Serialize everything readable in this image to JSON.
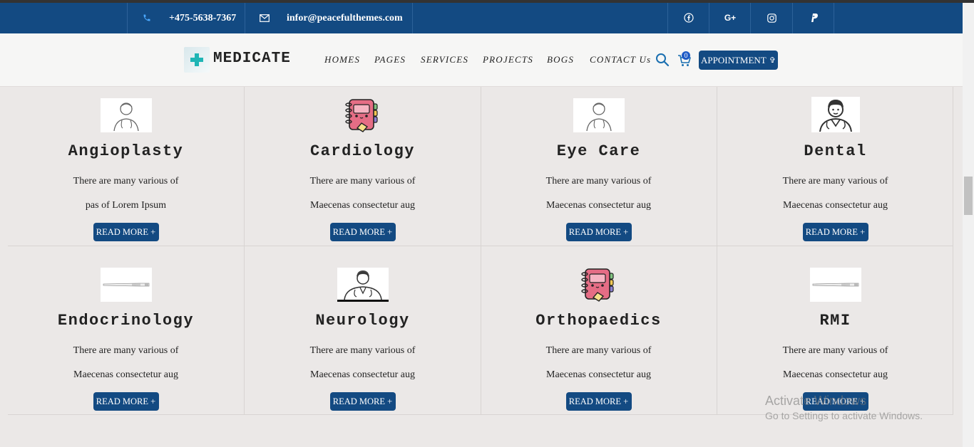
{
  "topbar": {
    "phone": "+475-5638-7367",
    "email": "infor@peacefulthemes.com",
    "social": [
      "facebook-icon",
      "google-plus-icon",
      "instagram-icon",
      "paypal-icon"
    ]
  },
  "brand": {
    "name": "MEDICATE"
  },
  "nav": {
    "items": [
      "HOMES",
      "PAGES",
      "SERVICES",
      "PROJECTS",
      "BOGS",
      "CONTACT Us"
    ],
    "cart_count": "0",
    "appointment": "APPOINTMENT"
  },
  "services": [
    {
      "title": "Angioplasty",
      "line1": "There are many various of",
      "line2": "pas of Lorem Ipsum",
      "button": "READ MORE +",
      "icon": "doctor-icon"
    },
    {
      "title": "Cardiology",
      "line1": "There are many various of",
      "line2": "Maecenas consectetur aug",
      "button": "READ MORE +",
      "icon": "notebook-icon"
    },
    {
      "title": "Eye Care",
      "line1": "There are many various of",
      "line2": "Maecenas consectetur aug",
      "button": "READ MORE +",
      "icon": "doctor-icon"
    },
    {
      "title": "Dental",
      "line1": "There are many various of",
      "line2": "Maecenas consectetur aug",
      "button": "READ MORE +",
      "icon": "doctor-icon"
    },
    {
      "title": "Endocrinology",
      "line1": "There are many various of",
      "line2": "Maecenas consectetur aug",
      "button": "READ MORE +",
      "icon": "thermometer-icon"
    },
    {
      "title": "Neurology",
      "line1": "There are many various of",
      "line2": "Maecenas consectetur aug",
      "button": "READ MORE +",
      "icon": "doctor-icon"
    },
    {
      "title": "Orthopaedics",
      "line1": "There are many various of",
      "line2": "Maecenas consectetur aug",
      "button": "READ MORE +",
      "icon": "notebook-icon"
    },
    {
      "title": "RMI",
      "line1": "There are many various of",
      "line2": "Maecenas consectetur aug",
      "button": "READ MORE +",
      "icon": "thermometer-icon"
    }
  ],
  "watermark": {
    "line1": "Activate Windows",
    "line2": "Go to Settings to activate Windows."
  },
  "colors": {
    "brand_blue": "#134a82",
    "page_bg": "#ebe8e7",
    "accent_teal": "#1fb5b5"
  }
}
